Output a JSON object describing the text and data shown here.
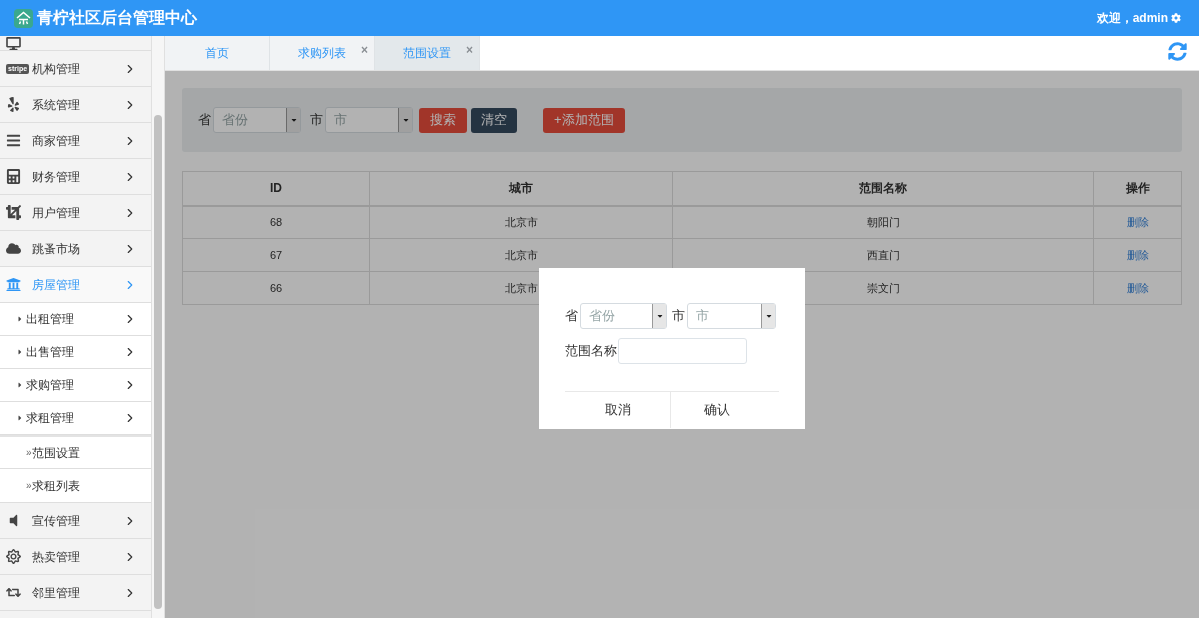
{
  "header": {
    "title": "青柠社区后台管理中心",
    "welcome": "欢迎，admin"
  },
  "sidebar": {
    "items": [
      {
        "label": "机构管理",
        "badge": "stripe",
        "selected": false
      },
      {
        "label": "系统管理",
        "selected": false
      },
      {
        "label": "商家管理",
        "selected": false
      },
      {
        "label": "财务管理",
        "selected": false
      },
      {
        "label": "用户管理",
        "selected": false
      },
      {
        "label": "跳蚤市场",
        "selected": false
      },
      {
        "label": "房屋管理",
        "selected": true,
        "children": [
          {
            "label": "出租管理"
          },
          {
            "label": "出售管理"
          },
          {
            "label": "求购管理"
          },
          {
            "label": "求租管理",
            "children": [
              {
                "bullet": "»",
                "label": "范围设置"
              },
              {
                "bullet": "»",
                "label": "求租列表"
              }
            ]
          }
        ]
      },
      {
        "label": "宣传管理",
        "selected": false
      },
      {
        "label": "热卖管理",
        "selected": false
      },
      {
        "label": "邻里管理",
        "selected": false
      }
    ]
  },
  "tabs": [
    {
      "label": "首页",
      "selected": false
    },
    {
      "label": "求购列表",
      "selected": false,
      "close": "×"
    },
    {
      "label": "范围设置",
      "selected": true,
      "close": "×"
    }
  ],
  "filter": {
    "province_label": "省",
    "province_placeholder": "省份",
    "city_label": "市",
    "city_placeholder": "市",
    "search": "搜索",
    "clear": "清空",
    "add": "+添加范围"
  },
  "table": {
    "columns": [
      "ID",
      "城市",
      "范围名称",
      "操作"
    ],
    "rows": [
      {
        "id": "68",
        "city": "北京市",
        "name": "朝阳门",
        "action": "删除"
      },
      {
        "id": "67",
        "city": "北京市",
        "name": "西直门",
        "action": "删除"
      },
      {
        "id": "66",
        "city": "北京市",
        "name": "崇文门",
        "action": "删除"
      }
    ]
  },
  "dialog": {
    "province_label": "省",
    "province_placeholder": "省份",
    "city_label": "市",
    "city_placeholder": "市",
    "name_label": "范围名称",
    "cancel": "取消",
    "confirm": "确认"
  }
}
